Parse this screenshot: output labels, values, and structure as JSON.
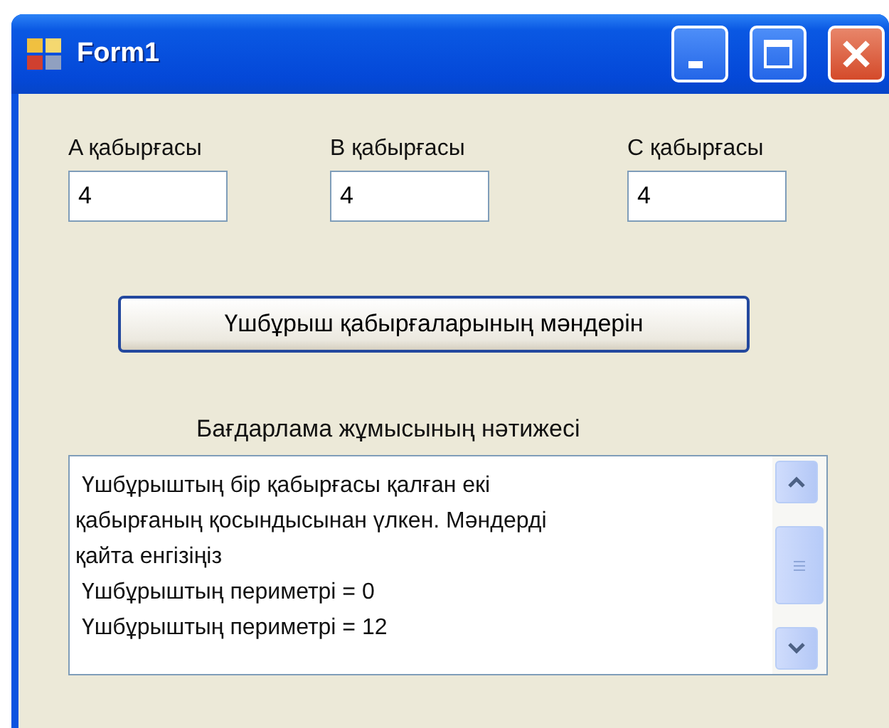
{
  "window": {
    "title": "Form1"
  },
  "fields": [
    {
      "label": "A қабырғасы",
      "value": "4"
    },
    {
      "label": "B қабырғасы",
      "value": "4"
    },
    {
      "label": "C қабырғасы",
      "value": "4"
    }
  ],
  "button": "Үшбұрыш қабырғаларының мәндерін",
  "result": {
    "label": "Бағдарлама жұмысының нәтижесі",
    "lines": [
      " Үшбұрыштың бір қабырғасы қалған екі",
      "қабырғаның қосындысынан үлкен. Мәндерді",
      "қайта енгізіңіз",
      " Үшбұрыштың периметрі = 0",
      " Үшбұрыштың периметрі = 12"
    ]
  }
}
